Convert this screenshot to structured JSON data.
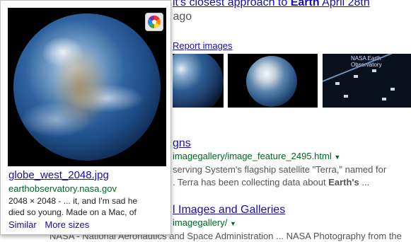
{
  "serp": {
    "top_title_prefix": "it's closest approach to ",
    "top_title_bold": "Earth",
    "top_title_suffix": " April 28th",
    "top_meta": "s ago",
    "report_images": "Report images",
    "thumb3_label": "NASA Earth Observatory",
    "result1": {
      "title": "gns",
      "url": "imagegallery/image_feature_2495.html",
      "snippet_line1": "serving System's flagship satellite \"Terra,\" named for",
      "snippet_line2_prefix": ". Terra has been collecting data about ",
      "snippet_line2_bold": "Earth's",
      "snippet_line2_suffix": " ..."
    },
    "result2": {
      "title": "l Images and Galleries",
      "url": "imagegallery/",
      "snippet_line1": "NASA - National Aeronautics and Space Administration ... NASA Photography from the"
    }
  },
  "card": {
    "filename": "globe_west_2048.jpg",
    "domain": "earthobservatory.nasa.gov",
    "desc_line1": "2048 × 2048 - ... it, and I'm sad he",
    "desc_line2": "died so young. Made on a Mac, of",
    "similar": "Similar",
    "more_sizes": "More sizes"
  }
}
